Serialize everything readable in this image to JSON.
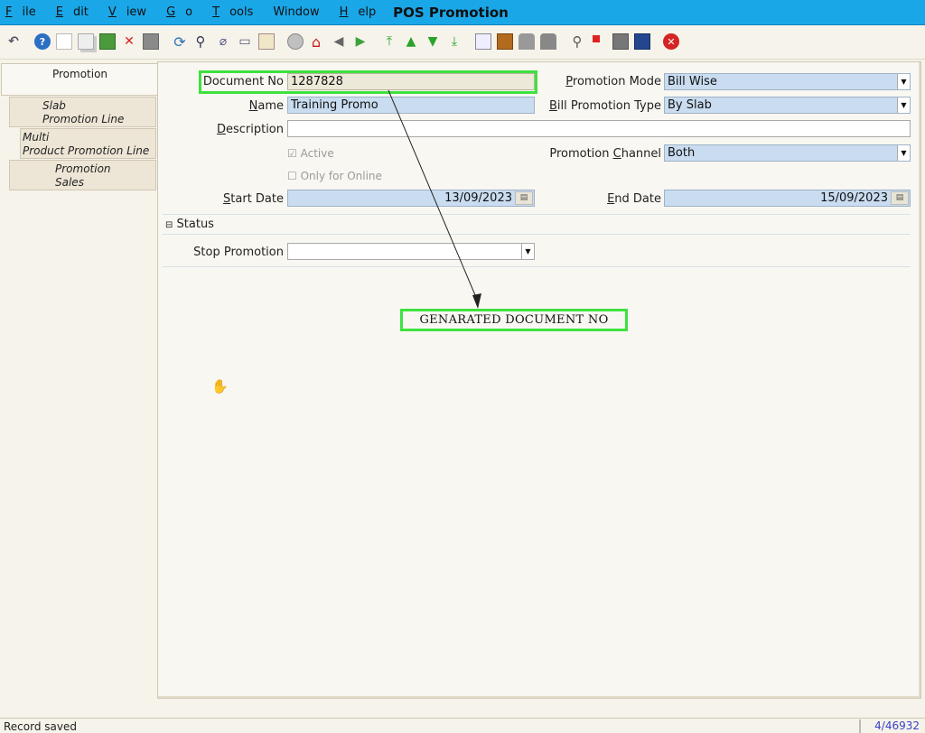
{
  "window": {
    "title": "POS Promotion"
  },
  "menu": [
    {
      "u": "F",
      "rest": "ile"
    },
    {
      "u": "E",
      "rest": "dit"
    },
    {
      "u": "V",
      "rest": "iew"
    },
    {
      "u": "G",
      "rest": "o"
    },
    {
      "u": "T",
      "rest": "ools"
    },
    {
      "u": "",
      "rest": "Window"
    },
    {
      "u": "H",
      "rest": "elp"
    }
  ],
  "toolbar": {
    "icons": [
      "undo-icon",
      "help-icon",
      "new-record-icon",
      "copy-record-icon",
      "save-new-icon",
      "delete-icon",
      "save-icon",
      "refresh-icon",
      "find-icon",
      "attachment-icon",
      "chat-icon",
      "grid-toggle-icon",
      "history-icon",
      "home-icon",
      "back-icon",
      "forward-icon",
      "first-record-icon",
      "previous-record-icon",
      "next-record-icon",
      "last-record-icon",
      "report-icon",
      "archive-icon",
      "print-preview-icon",
      "print-icon",
      "zoom-across-icon",
      "active-workflows-icon",
      "request-icon",
      "product-info-icon",
      "close-window-icon"
    ]
  },
  "tabs": [
    {
      "line1": "Promotion",
      "line2": ""
    },
    {
      "line1": "Slab",
      "line2": "Promotion Line"
    },
    {
      "line1": "Multi",
      "line2": "Product Promotion Line"
    },
    {
      "line1": "Promotion",
      "line2": "Sales"
    }
  ],
  "form": {
    "document_no": {
      "label": "Document No",
      "value": "1287828"
    },
    "name": {
      "label_u": "N",
      "label_rest": "ame",
      "value": "Training Promo"
    },
    "description": {
      "label_u": "D",
      "label_rest": "escription",
      "value": ""
    },
    "active": {
      "label": "Active",
      "checked": true
    },
    "only_online": {
      "label": "Only for Online",
      "checked": false
    },
    "start_date": {
      "label_u": "S",
      "label_rest": "tart Date",
      "value": "13/09/2023"
    },
    "promotion_mode": {
      "label_u": "P",
      "label_rest": "romotion Mode",
      "value": "Bill Wise"
    },
    "bill_promotion_type": {
      "label_u": "B",
      "label_rest": "ill Promotion Type",
      "value": "By Slab"
    },
    "promotion_channel": {
      "label_pre": "Promotion ",
      "label_u": "C",
      "label_rest": "hannel",
      "value": "Both"
    },
    "end_date": {
      "label_u": "E",
      "label_rest": "nd Date",
      "value": "15/09/2023"
    },
    "status_section": "Status",
    "stop_promotion": {
      "label": "Stop Promotion",
      "value": ""
    }
  },
  "annotation": {
    "callout_text": "GENARATED  DOCUMENT  NO",
    "highlight_color": "#3ee23e"
  },
  "status": {
    "message": "Record saved",
    "record": "4/46932"
  }
}
